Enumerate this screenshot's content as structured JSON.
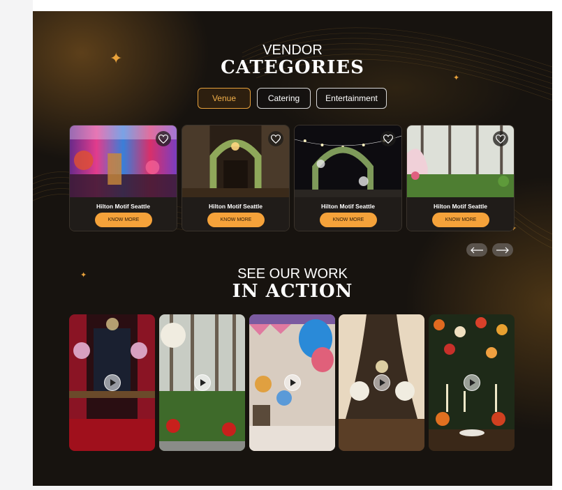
{
  "vendor_section": {
    "title_small": "VENDOR",
    "title_big": "CATEGORIES",
    "tabs": [
      {
        "label": "Venue",
        "active": true
      },
      {
        "label": "Catering",
        "active": false
      },
      {
        "label": "Entertainment",
        "active": false
      }
    ],
    "cards": [
      {
        "name": "Hilton Motif Seattle",
        "button": "KNOW MORE",
        "icon": "heart-icon"
      },
      {
        "name": "Hilton Motif Seattle",
        "button": "KNOW MORE",
        "icon": "heart-icon"
      },
      {
        "name": "Hilton Motif Seattle",
        "button": "KNOW MORE",
        "icon": "heart-icon"
      },
      {
        "name": "Hilton Motif Seattle",
        "button": "KNOW MORE",
        "icon": "heart-icon"
      }
    ],
    "nav": {
      "prev_icon": "arrow-left-icon",
      "next_icon": "arrow-right-icon"
    }
  },
  "work_section": {
    "title_small": "SEE OUR WORK",
    "title_big": "IN ACTION",
    "videos": [
      {
        "subject": "banquet-hall",
        "icon": "play-icon"
      },
      {
        "subject": "garden-trees",
        "icon": "play-icon"
      },
      {
        "subject": "balloons",
        "icon": "play-icon"
      },
      {
        "subject": "draped-hall",
        "icon": "play-icon"
      },
      {
        "subject": "flower-table",
        "icon": "play-icon"
      }
    ]
  },
  "colors": {
    "accent": "#f5a23a",
    "background": "#17130f",
    "text": "#ffffff"
  }
}
